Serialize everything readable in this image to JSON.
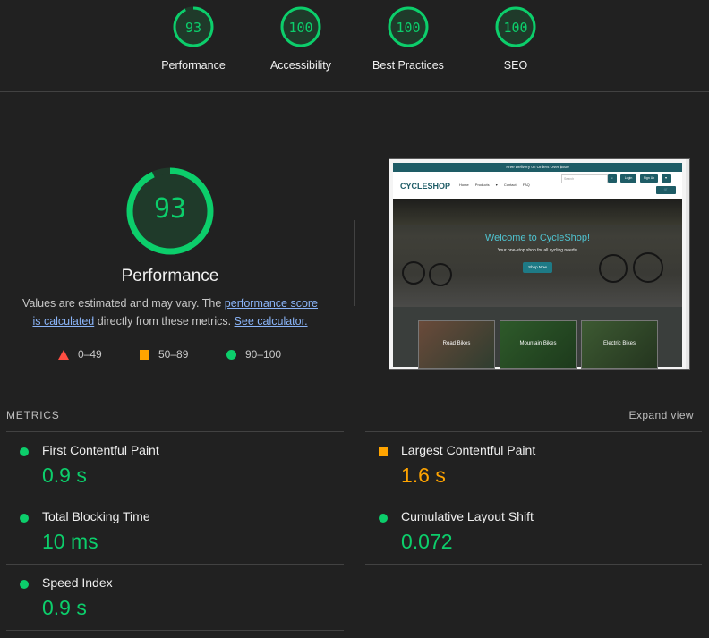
{
  "categories": [
    {
      "score": "93",
      "label": "Performance",
      "fraction": 0.93
    },
    {
      "score": "100",
      "label": "Accessibility",
      "fraction": 1.0
    },
    {
      "score": "100",
      "label": "Best Practices",
      "fraction": 1.0
    },
    {
      "score": "100",
      "label": "SEO",
      "fraction": 1.0
    }
  ],
  "performance": {
    "score": "93",
    "fraction": 0.93,
    "title": "Performance",
    "note_prefix": "Values are estimated and may vary. The ",
    "note_link1": "performance score is calculated",
    "note_mid": " directly from these metrics. ",
    "note_link2": "See calculator."
  },
  "legend": {
    "fail": "0–49",
    "average": "50–89",
    "pass": "90–100"
  },
  "screenshot": {
    "banner": "Free Delivery on Orders Over $500",
    "logo": "CYCLESHOP",
    "nav": [
      "Home",
      "Products ▾",
      "Contact",
      "FAQ"
    ],
    "search_placeholder": "Search",
    "login": "Login",
    "signup": "Sign Up",
    "hero_title": "Welcome to CycleShop!",
    "hero_subtitle": "Your one-stop shop for all cycling needs!",
    "hero_button": "Shop Now",
    "cards": [
      "Road Bikes",
      "Mountain Bikes",
      "Electric Bikes"
    ]
  },
  "metrics": {
    "header": "METRICS",
    "expand": "Expand view",
    "items": [
      {
        "name": "First Contentful Paint",
        "value": "0.9 s",
        "status": "pass"
      },
      {
        "name": "Largest Contentful Paint",
        "value": "1.6 s",
        "status": "average"
      },
      {
        "name": "Total Blocking Time",
        "value": "10 ms",
        "status": "pass"
      },
      {
        "name": "Cumulative Layout Shift",
        "value": "0.072",
        "status": "pass"
      },
      {
        "name": "Speed Index",
        "value": "0.9 s",
        "status": "pass"
      }
    ]
  },
  "colors": {
    "pass": "#0cce6b",
    "average": "#ffa400",
    "fail": "#ff4e42",
    "background": "#212121"
  }
}
